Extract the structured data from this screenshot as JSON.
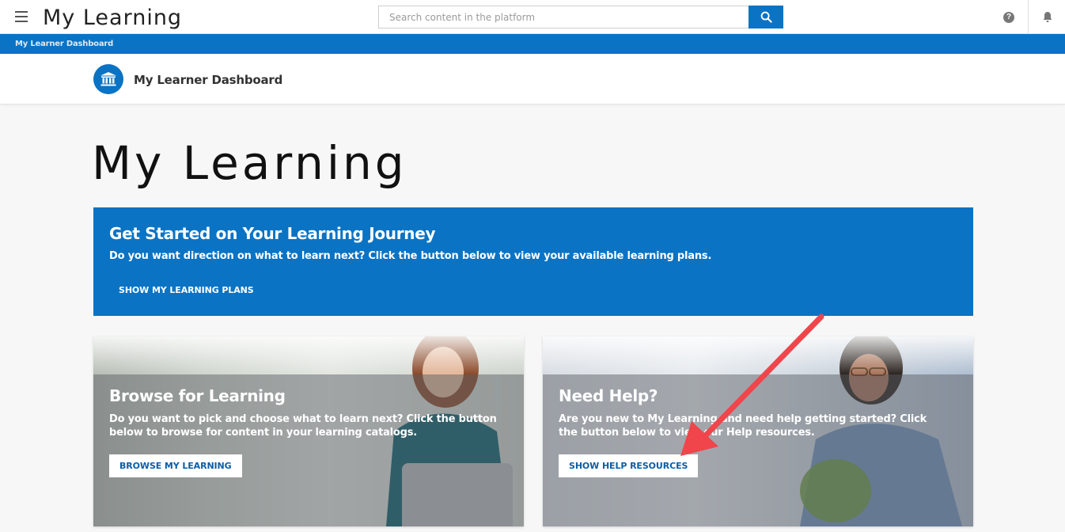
{
  "topbar": {
    "app_title": "My Learning",
    "search_placeholder": "Search content in the platform",
    "help_glyph": "?"
  },
  "breadcrumb": {
    "current": "My Learner Dashboard"
  },
  "header": {
    "title": "My Learner Dashboard",
    "icon": "institution-icon"
  },
  "page_title": "My Learning",
  "banner": {
    "title": "Get Started on Your Learning Journey",
    "text": "Do you want direction on what to learn next? Click the button below to view your available learning plans.",
    "button": "SHOW MY LEARNING PLANS"
  },
  "cards": [
    {
      "title": "Browse for Learning",
      "text": "Do you want to pick and choose what to learn next? Click the button below to browse for content in your learning catalogs.",
      "button": "BROWSE MY LEARNING"
    },
    {
      "title": "Need Help?",
      "text": "Are you new to My Learning and need help getting started? Click the button below to view our Help resources.",
      "button": "SHOW HELP RESOURCES"
    }
  ],
  "colors": {
    "brand_blue": "#0a73c4",
    "annotation_red": "#f0454b"
  }
}
